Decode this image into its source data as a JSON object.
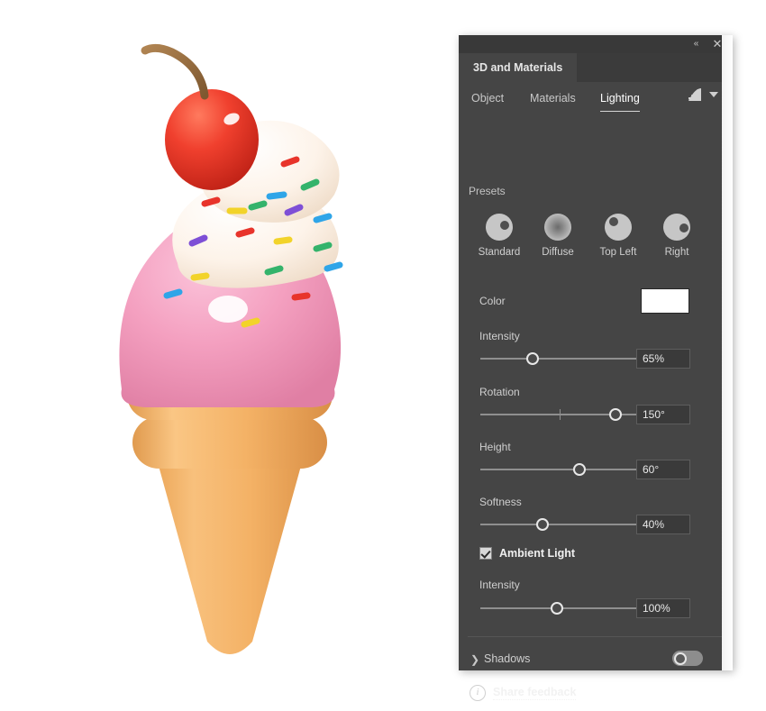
{
  "window": {
    "titlebar": {
      "collapse_icon": "collapse-double-left-icon",
      "collapse_label": "«",
      "close_icon": "close-icon",
      "close_label": "✕"
    },
    "panel_tab": "3D and Materials"
  },
  "section_tabs": [
    {
      "key": "object",
      "label": "Object",
      "active": false
    },
    {
      "key": "materials",
      "label": "Materials",
      "active": false
    },
    {
      "key": "lighting",
      "label": "Lighting",
      "active": true
    }
  ],
  "render_menu": {
    "icon": "render-quality-icon",
    "chevron": "chevron-down-icon"
  },
  "lighting": {
    "presets_label": "Presets",
    "presets": [
      {
        "label": "Standard",
        "style": "dot-center-right"
      },
      {
        "label": "Diffuse",
        "style": "radial-soft"
      },
      {
        "label": "Top Left",
        "style": "dot-top-left"
      },
      {
        "label": "Right",
        "style": "dot-right"
      }
    ],
    "color": {
      "label": "Color",
      "value": "#FFFFFF"
    },
    "intensity": {
      "label": "Intensity",
      "value": "65%",
      "percent": 33
    },
    "rotation": {
      "label": "Rotation",
      "value": "150°",
      "percent": 85,
      "tick_percent": 50
    },
    "height": {
      "label": "Height",
      "value": "60°",
      "percent": 63
    },
    "softness": {
      "label": "Softness",
      "value": "40%",
      "percent": 39
    },
    "ambient": {
      "label": "Ambient Light",
      "checked": true,
      "intensity": {
        "label": "Intensity",
        "value": "100%",
        "percent": 48
      }
    }
  },
  "footer": {
    "shadows": {
      "label": "Shadows",
      "arrow_icon": "chevron-right-icon",
      "toggle_on": false
    },
    "feedback": {
      "label": "Share feedback",
      "icon": "info-icon"
    }
  },
  "artwork": {
    "name": "3d-ice-cream-cone",
    "colors": {
      "cone": "#F4B266",
      "cone_shade": "#E09A4E",
      "scoop": "#F4A0C0",
      "cream": "#FFF6EE",
      "cherry": "#F0402E",
      "stem": "#9E7040"
    },
    "sprinkle_colors": [
      "#E8342B",
      "#2FA5E8",
      "#34B36B",
      "#F2D32A",
      "#7E4FD6"
    ]
  }
}
